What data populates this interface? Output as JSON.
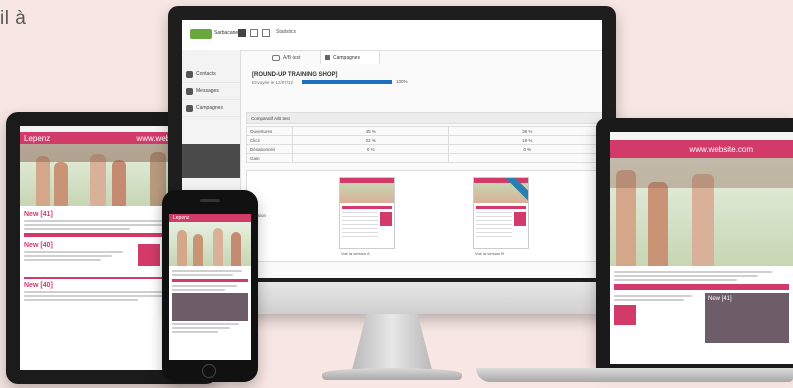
{
  "corner_text": "il à",
  "app": {
    "logo": "Sarbacane",
    "breadcrumb": "Statistics",
    "tabs": [
      {
        "label": "A/B test"
      },
      {
        "label": "Campagnes"
      }
    ],
    "sidebar": [
      {
        "label": "Contacts"
      },
      {
        "label": "Messages"
      },
      {
        "label": "Campagnes"
      }
    ],
    "campaign_title": "[ROUND-UP TRAINING SHOP]",
    "campaign_meta": "Envoyée le 12/07/12",
    "progress_label": "100%",
    "progress_fraction": 1.0,
    "section_title": "Comparatif A/B test",
    "table_rows": [
      {
        "label": "Ouvertures",
        "a": "45 %",
        "b": "38 %"
      },
      {
        "label": "Clics",
        "a": "22 %",
        "b": "19 %"
      },
      {
        "label": "Désabonnés",
        "a": "0 %",
        "b": "0 %"
      },
      {
        "label": "Gain",
        "a": "",
        "b": ""
      }
    ],
    "version_row_label": "Version",
    "version_a_caption": "Voir la version A",
    "version_b_caption": "Voir la version B"
  },
  "newsletter": {
    "brand": "Lepenz",
    "site": "www.website.com",
    "headline": "New [41]",
    "sub_headline": "New [40]",
    "promo_text": "New [41]"
  },
  "colors": {
    "accent": "#d23a6a",
    "blue_progress": "#1f6fc1",
    "promo": "#6c5d69"
  }
}
